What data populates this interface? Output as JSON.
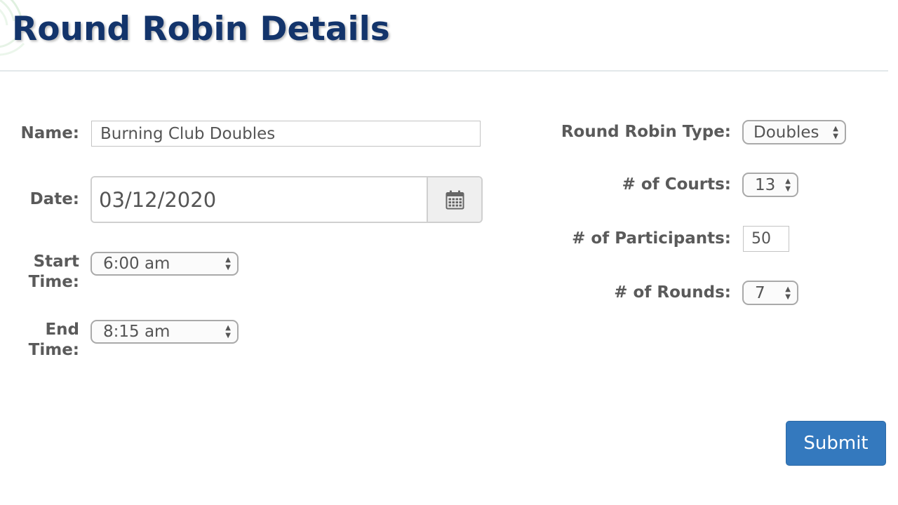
{
  "header": {
    "title": "Round Robin Details"
  },
  "form": {
    "name": {
      "label": "Name:",
      "value": "Burning Club Doubles"
    },
    "date": {
      "label": "Date:",
      "value": "03/12/2020",
      "icon": "calendar-icon"
    },
    "start_time": {
      "label_line1": "Start",
      "label_line2": "Time:",
      "value": "6:00 am"
    },
    "end_time": {
      "label_line1": "End",
      "label_line2": "Time:",
      "value": "8:15 am"
    },
    "round_robin_type": {
      "label": "Round Robin Type:",
      "value": "Doubles"
    },
    "courts": {
      "label": "# of Courts:",
      "value": "13"
    },
    "participants": {
      "label": "# of Participants:",
      "value": "50"
    },
    "rounds": {
      "label": "# of Rounds:",
      "value": "7"
    },
    "submit_label": "Submit"
  },
  "colors": {
    "title": "#13346b",
    "label": "#5a5a5a",
    "submit_bg": "#3479be",
    "logo_arc": "#dff0df"
  }
}
